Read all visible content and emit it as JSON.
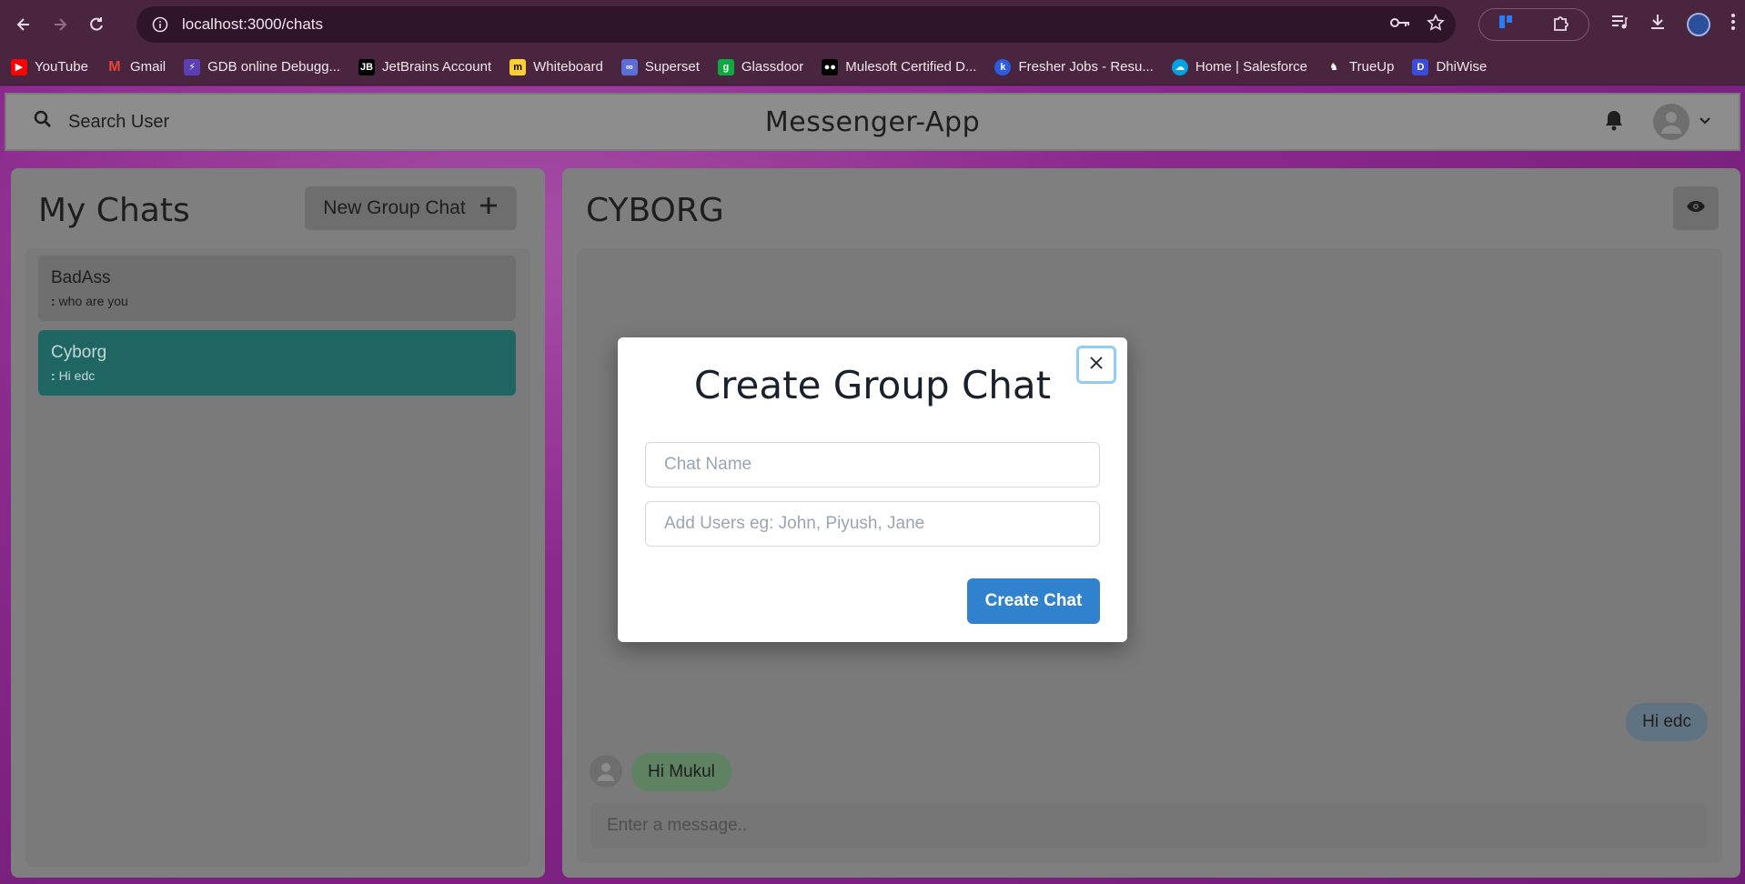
{
  "browser": {
    "url": "localhost:3000/chats",
    "bookmarks": [
      {
        "label": "YouTube",
        "color": "#ff0000"
      },
      {
        "label": "Gmail",
        "color": "#ea4335"
      },
      {
        "label": "GDB online Debugg...",
        "color": "#5b3fb5"
      },
      {
        "label": "JetBrains Account",
        "color": "#000000"
      },
      {
        "label": "Whiteboard",
        "color": "#ffd02f"
      },
      {
        "label": "Superset",
        "color": "#5b6fd6"
      },
      {
        "label": "Glassdoor",
        "color": "#0caa41"
      },
      {
        "label": "Mulesoft Certified D...",
        "color": "#000000"
      },
      {
        "label": "Fresher Jobs - Resu...",
        "color": "#2b5de0"
      },
      {
        "label": "Home | Salesforce",
        "color": "#00a1e0"
      },
      {
        "label": "TrueUp",
        "color": "#ffffff"
      },
      {
        "label": "DhiWise",
        "color": "#3b4bdc"
      }
    ]
  },
  "appbar": {
    "search_label": "Search User",
    "title": "Messenger-App"
  },
  "sidebar": {
    "heading": "My Chats",
    "new_group_label": "New Group Chat",
    "chats": [
      {
        "name": "BadAss",
        "sender": ":",
        "preview": "who are you",
        "active": false
      },
      {
        "name": "Cyborg",
        "sender": ":",
        "preview": "Hi edc",
        "active": true
      }
    ]
  },
  "chat": {
    "title": "CYBORG",
    "messages": [
      {
        "text": "Hi edc",
        "mine": true
      },
      {
        "text": "Hi Mukul",
        "mine": false
      }
    ],
    "input_placeholder": "Enter a message.."
  },
  "modal": {
    "title": "Create Group Chat",
    "chat_name_placeholder": "Chat Name",
    "users_placeholder": "Add Users eg: John, Piyush, Jane",
    "create_label": "Create Chat"
  },
  "colors": {
    "accent": "#3182ce",
    "active_chat": "#1f6662",
    "close_focus": "#90cdf4"
  }
}
